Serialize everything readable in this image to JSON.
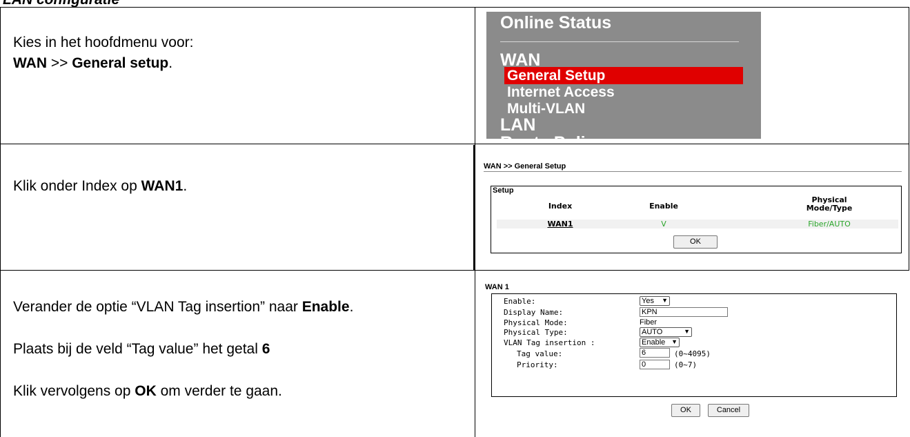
{
  "heading": "LAN configuratie",
  "rows": [
    {
      "text_lines": [
        {
          "parts": [
            {
              "t": "Kies in het hoofdmenu voor:",
              "b": false
            }
          ]
        },
        {
          "parts": [
            {
              "t": "WAN",
              "b": true
            },
            {
              "t": " >> ",
              "b": false
            },
            {
              "t": "General setup",
              "b": true
            },
            {
              "t": ".",
              "b": false
            }
          ]
        }
      ]
    },
    {
      "text_lines": [
        {
          "parts": [
            {
              "t": "Klik onder Index op ",
              "b": false
            },
            {
              "t": "WAN1",
              "b": true
            },
            {
              "t": ".",
              "b": false
            }
          ]
        }
      ]
    },
    {
      "text_lines": [
        {
          "parts": [
            {
              "t": "Verander de optie “VLAN Tag insertion” naar ",
              "b": false
            },
            {
              "t": "Enable",
              "b": true
            },
            {
              "t": ".",
              "b": false
            }
          ]
        },
        {
          "parts": [
            {
              "t": "Plaats bij de veld “Tag value” het getal ",
              "b": false
            },
            {
              "t": "6",
              "b": true
            }
          ]
        },
        {
          "parts": [
            {
              "t": "Klik vervolgens op ",
              "b": false
            },
            {
              "t": "OK",
              "b": true
            },
            {
              "t": " om verder te gaan.",
              "b": false
            }
          ]
        }
      ]
    }
  ],
  "menu_screenshot": {
    "online_status": "Online Status",
    "wan": "WAN",
    "items": [
      "General Setup",
      "Internet Access",
      "Multi-VLAN"
    ],
    "active_item": "General Setup",
    "lan": "LAN",
    "next_partial": "Route Poli",
    "colors": {
      "bg": "#8b8b8b",
      "active": "#e00000"
    }
  },
  "general_setup_screenshot": {
    "breadcrumb": "WAN >> General Setup",
    "box_label": "Setup",
    "headers": {
      "index": "Index",
      "enable": "Enable",
      "physical": "Physical",
      "mode_type": "Mode/Type"
    },
    "row": {
      "index": "WAN1",
      "enable": "V",
      "physical": "Fiber/AUTO"
    },
    "ok": "OK"
  },
  "wan1_screenshot": {
    "title": "WAN 1",
    "labels": {
      "enable": "Enable:",
      "display_name": "Display Name:",
      "physical_mode": "Physical Mode:",
      "physical_type": "Physical Type:",
      "vlan_tag": "VLAN Tag insertion :",
      "tag_value": "Tag value:",
      "priority": "Priority:"
    },
    "values": {
      "enable": "Yes",
      "display_name": "KPN",
      "physical_mode": "Fiber",
      "physical_type": "AUTO",
      "vlan_tag": "Enable",
      "tag_value": "6",
      "tag_hint": "(0~4095)",
      "priority": "0",
      "priority_hint": "(0~7)"
    },
    "ok": "OK",
    "cancel": "Cancel"
  }
}
